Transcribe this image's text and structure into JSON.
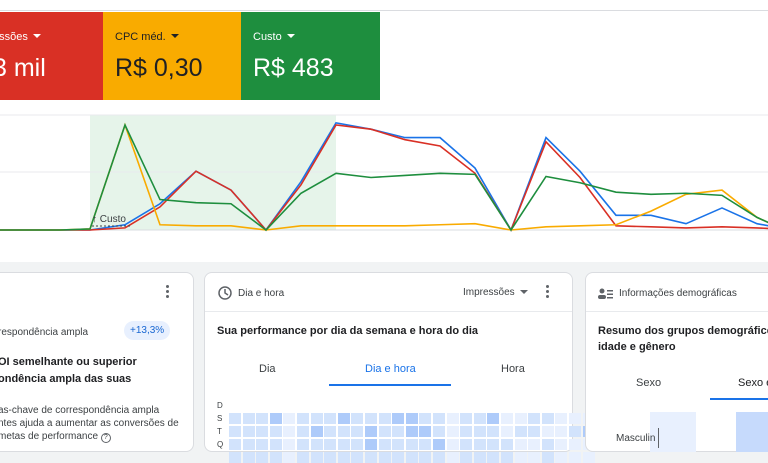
{
  "tiles": [
    {
      "label": "essões",
      "value": "3 mil"
    },
    {
      "label": "CPC méd.",
      "value": "R$ 0,30"
    },
    {
      "label": "Custo",
      "value": "R$ 483"
    }
  ],
  "chart_data": {
    "type": "line",
    "annotation": "Custo",
    "x": [
      0,
      1,
      2,
      3,
      4,
      5,
      6,
      7,
      8,
      9,
      10,
      11,
      12,
      13,
      14,
      15,
      16,
      17,
      18,
      19,
      20,
      21,
      22,
      23,
      24,
      25,
      26,
      27,
      28,
      29,
      30
    ],
    "series": [
      {
        "color": "#1a73e8",
        "values": [
          0,
          0,
          0,
          0,
          0.5,
          2.5,
          5.6,
          3.8,
          0,
          4.6,
          10.2,
          9.6,
          8.8,
          8.8,
          5.9,
          0,
          8.8,
          5.6,
          1.4,
          1.4,
          0.6,
          2.1,
          0.6,
          0.2,
          0.6
        ]
      },
      {
        "color": "#d93025",
        "values": [
          0,
          0,
          0,
          0,
          0.2,
          2.2,
          5.6,
          3.8,
          0,
          4.3,
          10.0,
          9.6,
          8.6,
          8.0,
          5.4,
          0,
          8.4,
          5.0,
          0.4,
          0.3,
          0.2,
          0.3,
          0.2,
          0.1,
          0.2
        ]
      },
      {
        "color": "#f9ab00",
        "values": [
          0,
          0,
          0,
          0.1,
          10.0,
          0.5,
          0.4,
          0.4,
          0,
          0.4,
          0.4,
          0.4,
          0.4,
          0.5,
          0.6,
          0,
          0.3,
          0.4,
          0.5,
          1.8,
          3.4,
          3.8,
          1.2,
          0.2,
          0.1
        ]
      },
      {
        "color": "#1e8e3e",
        "values": [
          0,
          0,
          0,
          0.1,
          10.0,
          2.9,
          2.6,
          2.5,
          0,
          3.5,
          5.4,
          5.0,
          5.2,
          5.4,
          5.3,
          0,
          5.1,
          4.5,
          3.6,
          3.4,
          3.5,
          3.3,
          1.2,
          0.2,
          0.1
        ]
      }
    ]
  },
  "card1": {
    "title": "respondência ampla",
    "badge": "+13,3%",
    "headline1": "OI semelhante ou superior",
    "headline2": "ondência ampla das suas",
    "body1": "as-chave de correspondência ampla",
    "body2": "ntes ajuda a aumentar as conversões de",
    "body3": "metas de performance"
  },
  "card2": {
    "header": "Dia e hora",
    "metric": "Impressões",
    "title": "Sua performance por dia da semana e hora do dia",
    "tabs": [
      "Dia",
      "Dia e hora",
      "Hora"
    ],
    "rows": [
      "D",
      "S",
      "T",
      "Q"
    ],
    "intensity": [
      [
        2,
        2,
        2,
        3,
        1,
        2,
        2,
        2,
        3,
        2,
        2,
        2,
        3,
        3,
        2,
        2,
        1,
        2,
        2,
        3,
        1,
        1,
        2,
        2,
        1,
        1,
        1,
        0
      ],
      [
        2,
        2,
        2,
        2,
        1,
        2,
        3,
        2,
        2,
        2,
        3,
        2,
        2,
        3,
        3,
        2,
        1,
        2,
        2,
        2,
        1,
        2,
        2,
        1,
        1,
        2,
        3,
        0
      ],
      [
        2,
        2,
        2,
        2,
        1,
        2,
        2,
        2,
        2,
        2,
        3,
        2,
        2,
        2,
        2,
        3,
        1,
        2,
        2,
        2,
        2,
        1,
        1,
        2,
        1,
        1,
        1,
        0
      ],
      [
        2,
        2,
        2,
        2,
        1,
        2,
        2,
        2,
        2,
        2,
        2,
        2,
        2,
        2,
        2,
        2,
        1,
        2,
        2,
        2,
        2,
        1,
        1,
        2,
        1,
        1,
        1,
        0
      ]
    ]
  },
  "card3": {
    "header": "Informações demográficas",
    "title1": "Resumo dos grupos demográficos",
    "title2": "idade e gênero",
    "tabs": [
      "Sexo",
      "Sexo e"
    ],
    "row": "Masculin"
  }
}
